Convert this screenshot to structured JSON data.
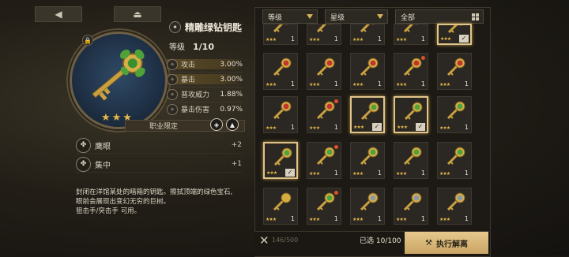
{
  "nav": {
    "back_icon": "back-arrow-icon",
    "eject_icon": "eject-icon"
  },
  "item": {
    "name": "精雕绿钻钥匙",
    "level_label": "等级",
    "level_value": "1/10",
    "stats": [
      {
        "label": "攻击",
        "value": "3.00%",
        "icon": "sword-icon",
        "highlight": true
      },
      {
        "label": "暴击",
        "value": "3.00%",
        "icon": "crit-icon",
        "highlight": true
      },
      {
        "label": "普攻威力",
        "value": "1.88%",
        "icon": "attack-power-icon",
        "highlight": false
      },
      {
        "label": "暴击伤害",
        "value": "0.97%",
        "icon": "crit-damage-icon",
        "highlight": false
      }
    ],
    "job_limit": "职业限定",
    "skills": [
      {
        "label": "鹰眼",
        "value": "+2",
        "icon": "eagle-eye-icon"
      },
      {
        "label": "集中",
        "value": "+1",
        "icon": "focus-icon"
      }
    ],
    "description": [
      "封闭在洋馆某处的暗箱的钥匙。擦拭顶端的绿色宝石,",
      "眼前会展现出变幻无穷的巨树。",
      "狙击手/突击手 可用。"
    ]
  },
  "filters": {
    "grade": "等级",
    "star": "星级",
    "all": "全部"
  },
  "inventory": {
    "colors": {
      "red": "#c2352b",
      "green": "#4fa23a",
      "silver": "#8d9aa6",
      "gold": "#d6a93e"
    },
    "rows": [
      [
        {
          "gem": "red",
          "n": "1",
          "sel": false,
          "chk": false,
          "dot": false
        },
        {
          "gem": "red",
          "n": "1",
          "sel": false,
          "chk": false,
          "dot": false
        },
        {
          "gem": "red",
          "n": "1",
          "sel": false,
          "chk": false,
          "dot": false
        },
        {
          "gem": "red",
          "n": "1",
          "sel": false,
          "chk": false,
          "dot": false
        },
        {
          "gem": "green",
          "n": "",
          "sel": true,
          "chk": true,
          "dot": false
        }
      ],
      [
        {
          "gem": "red",
          "n": "1",
          "sel": false,
          "chk": false,
          "dot": false
        },
        {
          "gem": "red",
          "n": "1",
          "sel": false,
          "chk": false,
          "dot": false
        },
        {
          "gem": "red",
          "n": "1",
          "sel": false,
          "chk": false,
          "dot": false
        },
        {
          "gem": "red",
          "n": "1",
          "sel": false,
          "chk": false,
          "dot": true
        },
        {
          "gem": "red",
          "n": "1",
          "sel": false,
          "chk": false,
          "dot": false
        }
      ],
      [
        {
          "gem": "red",
          "n": "1",
          "sel": false,
          "chk": false,
          "dot": false
        },
        {
          "gem": "red",
          "n": "1",
          "sel": false,
          "chk": false,
          "dot": true
        },
        {
          "gem": "green",
          "n": "",
          "sel": true,
          "chk": true,
          "dot": false
        },
        {
          "gem": "green",
          "n": "",
          "sel": true,
          "chk": true,
          "dot": false
        },
        {
          "gem": "green",
          "n": "1",
          "sel": false,
          "chk": false,
          "dot": false
        }
      ],
      [
        {
          "gem": "green",
          "n": "",
          "sel": true,
          "chk": true,
          "dot": false
        },
        {
          "gem": "green",
          "n": "1",
          "sel": false,
          "chk": false,
          "dot": true
        },
        {
          "gem": "green",
          "n": "1",
          "sel": false,
          "chk": false,
          "dot": false
        },
        {
          "gem": "green",
          "n": "1",
          "sel": false,
          "chk": false,
          "dot": false
        },
        {
          "gem": "green",
          "n": "1",
          "sel": false,
          "chk": false,
          "dot": false
        }
      ],
      [
        {
          "gem": "gold",
          "n": "1",
          "sel": false,
          "chk": false,
          "dot": false
        },
        {
          "gem": "green",
          "n": "1",
          "sel": false,
          "chk": false,
          "dot": true
        },
        {
          "gem": "silver",
          "n": "1",
          "sel": false,
          "chk": false,
          "dot": false
        },
        {
          "gem": "silver",
          "n": "1",
          "sel": false,
          "chk": false,
          "dot": false
        },
        {
          "gem": "silver",
          "n": "1",
          "sel": false,
          "chk": false,
          "dot": false
        }
      ]
    ]
  },
  "footer": {
    "capacity": "146/500",
    "selected": "已选 10/100",
    "dismantle": "执行解离"
  }
}
